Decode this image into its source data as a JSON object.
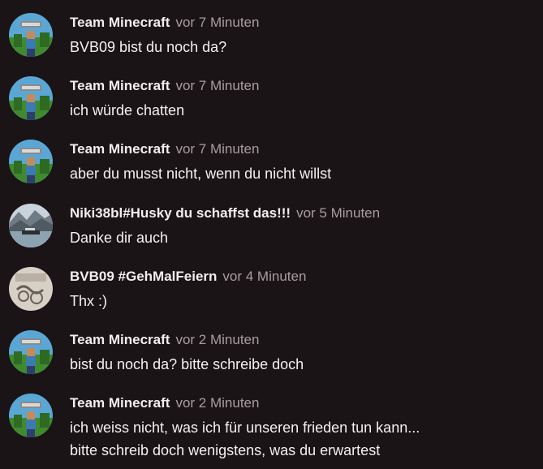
{
  "messages": [
    {
      "author": "Team Minecraft",
      "time": "vor 7 Minuten",
      "lines": [
        "BVB09 bist du noch da?"
      ],
      "avatar": "minecraft-avatar"
    },
    {
      "author": "Team Minecraft",
      "time": "vor 7 Minuten",
      "lines": [
        "ich würde chatten"
      ],
      "avatar": "minecraft-avatar"
    },
    {
      "author": "Team Minecraft",
      "time": "vor 7 Minuten",
      "lines": [
        "aber du musst nicht, wenn du nicht willst"
      ],
      "avatar": "minecraft-avatar"
    },
    {
      "author": "Niki38bl#Husky du schaffst das!!!",
      "time": "vor 5 Minuten",
      "lines": [
        "Danke dir auch"
      ],
      "avatar": "landscape-avatar"
    },
    {
      "author": "BVB09 #GehMalFeiern",
      "time": "vor 4 Minuten",
      "lines": [
        "Thx :)"
      ],
      "avatar": "sketch-avatar"
    },
    {
      "author": "Team Minecraft",
      "time": "vor 2 Minuten",
      "lines": [
        "bist du noch da? bitte schreibe doch"
      ],
      "avatar": "minecraft-avatar"
    },
    {
      "author": "Team Minecraft",
      "time": "vor 2 Minuten",
      "lines": [
        "ich weiss nicht, was ich für unseren frieden tun kann...",
        "bitte schreib doch wenigstens, was du erwartest"
      ],
      "avatar": "minecraft-avatar"
    }
  ],
  "colors": {
    "background": "#1a1416",
    "author": "#f2eef0",
    "timestamp": "#a79ea2",
    "text": "#f4f0f2"
  }
}
